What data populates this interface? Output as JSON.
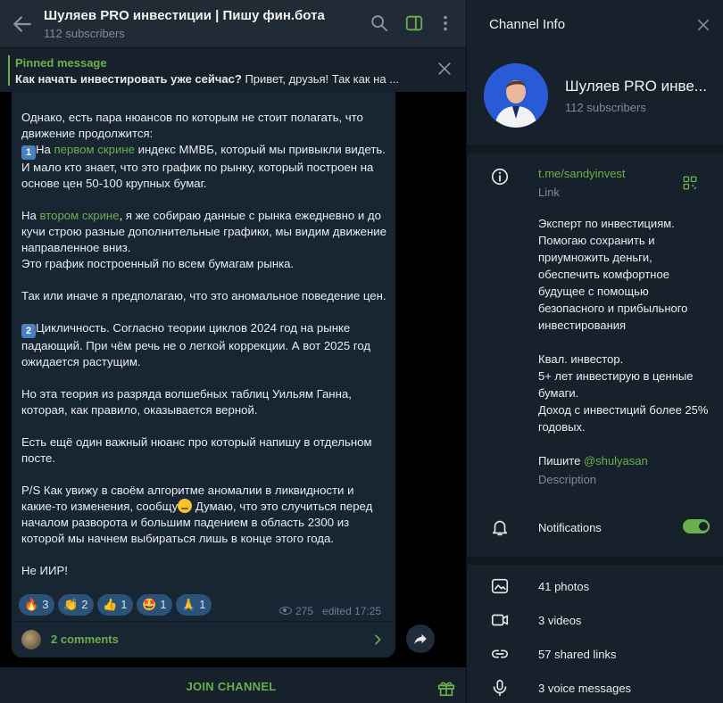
{
  "chat": {
    "title": "Шуляев PRO инвестиции | Пишу фин.бота",
    "subtitle": "112 subscribers",
    "pinned": {
      "label": "Pinned message",
      "bold": "Как начать инвестировать уже сейчас?",
      "text": "  Привет, друзья!  Так как на ..."
    },
    "message": {
      "p1": "Однако, есть пара нюансов по которым не стоит полагать, что движение продолжится:",
      "n1": "1",
      "p2_pre": "На ",
      "p2_link": "первом скрине",
      "p2_post": " индекс ММВБ, который мы привыкли видеть. И мало кто знает, что это график по рынку, который построен на основе цен 50-100 крупных бумаг.",
      "p3_pre": "На ",
      "p3_link": "втором скрине",
      "p3_post": ", я же собираю данные с рынка ежедневно и до кучи строю разные дополнительные графики, мы видим движение направленное вниз.",
      "p3_line2": "Это график построенный по всем бумагам рынка.",
      "p4": "Так или иначе я предполагаю, что это аномальное поведение цен.",
      "n2": "2",
      "p5": "Цикличность. Согласно теории циклов 2024 год на рынке падающий. При чём речь не о легкой коррекции. А вот 2025 год ожидается растущим.",
      "p6": "Но эта теория из разряда волшебных таблиц Уильям Ганна, которая, как правило, оказывается верной.",
      "p7": "Есть ещё один важный нюанс про который напишу в отдельном посте.",
      "p8_pre": "P/S Как увижу в своём алгоритме аномалии в ликвидности и какие-то изменения, сообщу",
      "p8_post": " Думаю, что это случиться перед началом разворота и большим падением в область 2300 из которой мы начнем выбираться лишь в конце этого года.",
      "p9": "Не ИИР!"
    },
    "reactions": [
      {
        "emoji": "🔥",
        "count": "3"
      },
      {
        "emoji": "👏",
        "count": "2"
      },
      {
        "emoji": "👍",
        "count": "1"
      },
      {
        "emoji": "🤩",
        "count": "1"
      },
      {
        "emoji": "🙏",
        "count": "1"
      }
    ],
    "views": "275",
    "edited": "edited 17:25",
    "comments": "2 comments",
    "join": "JOIN CHANNEL"
  },
  "info": {
    "title": "Channel Info",
    "name": "Шуляев PRO инве...",
    "subscribers": "112 subscribers",
    "link": "t.me/sandyinvest",
    "link_label": "Link",
    "desc_p1": "Эксперт по инвестициям. Помогаю сохранить и приумножить деньги, обеспечить комфортное будущее с помощью безопасного и прибыльного инвестирования",
    "desc_p2_l1": "Квал. инвестор.",
    "desc_p2_l2": "5+ лет инвестирую в ценные бумаги.",
    "desc_p2_l3": "Доход с инвестиций более 25% годовых.",
    "desc_p3_pre": "Пишите ",
    "desc_p3_link": "@shulyasan",
    "desc_label": "Description",
    "notifications": "Notifications",
    "notifications_on": true,
    "media": {
      "photos": "41 photos",
      "videos": "3 videos",
      "links": "57 shared links",
      "voice": "3 voice messages"
    }
  },
  "colors": {
    "accent": "#6ab04c",
    "bubble": "#182533",
    "panel": "#17212b",
    "header": "#202b36"
  }
}
